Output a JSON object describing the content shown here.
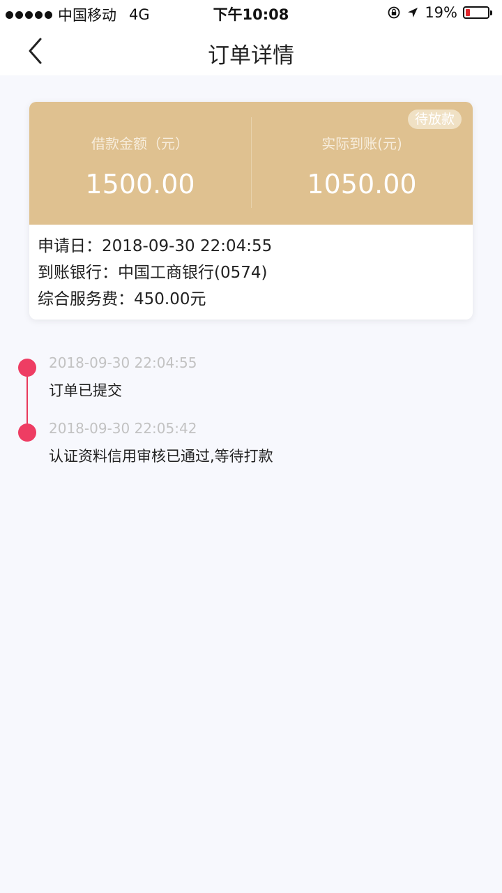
{
  "status_bar": {
    "carrier": "中国移动",
    "network": "4G",
    "time": "下午10:08",
    "battery_percent_text": "19%",
    "battery_level": 0.19,
    "battery_color": "#e0282e",
    "icons": [
      "signal-dots",
      "orientation-lock-icon",
      "location-arrow-icon",
      "battery-icon"
    ]
  },
  "nav": {
    "title": "订单详情",
    "back_icon": "chevron-left-icon"
  },
  "card": {
    "badge": "待放款",
    "loan_amount_label": "借款金额（元）",
    "loan_amount_value": "1500.00",
    "received_label": "实际到账(元)",
    "received_value": "1050.00",
    "header_color": "#dfc190",
    "info": {
      "apply_date": "申请日：2018-09-30 22:04:55",
      "bank": "到账银行：中国工商银行(0574)",
      "service_fee": "综合服务费：450.00元"
    }
  },
  "timeline": [
    {
      "time": "2018-09-30 22:04:55",
      "text": "订单已提交"
    },
    {
      "time": "2018-09-30 22:05:42",
      "text": "认证资料信用审核已通过,等待打款"
    }
  ],
  "accent_color": "#ee3d63"
}
